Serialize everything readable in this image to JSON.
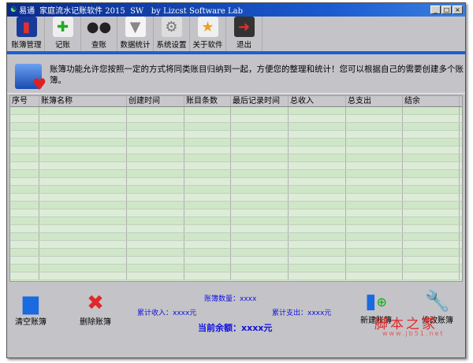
{
  "window": {
    "title_brand": "易通",
    "title": "家庭流水记账软件 2015  SW   by Lizcst Software Lab",
    "minimize": "_",
    "maximize": "□",
    "close": "×"
  },
  "toolbar": [
    {
      "label": "账簿管理",
      "icon": "ledger-book-icon"
    },
    {
      "label": "记账",
      "icon": "add-record-icon"
    },
    {
      "label": "查账",
      "icon": "binoculars-icon"
    },
    {
      "label": "数据统计",
      "icon": "funnel-icon"
    },
    {
      "label": "系统设置",
      "icon": "gear-icon"
    },
    {
      "label": "关于软件",
      "icon": "star-icon"
    },
    {
      "label": "退出",
      "icon": "exit-door-icon"
    }
  ],
  "info": {
    "text": "账簿功能允许您按照一定的方式将同类账目归纳到一起，方便您的整理和统计！您可以根据自己的需要创建多个账簿。"
  },
  "table": {
    "columns": [
      "序号",
      "账簿名称",
      "创建时间",
      "账目条数",
      "最后记录时间",
      "总收入",
      "总支出",
      "结余"
    ]
  },
  "bottom": {
    "clear": "清空账簿",
    "delete": "删除账簿",
    "new": "新建账簿",
    "edit": "修改账簿",
    "count": "账簿数量：xxxx",
    "income": "累计收入：xxxx元",
    "expense": "累计支出：xxxx元",
    "balance": "当前余额：xxxx元"
  },
  "watermark": {
    "text": "脚本之家",
    "url": "www.jb51.net"
  }
}
